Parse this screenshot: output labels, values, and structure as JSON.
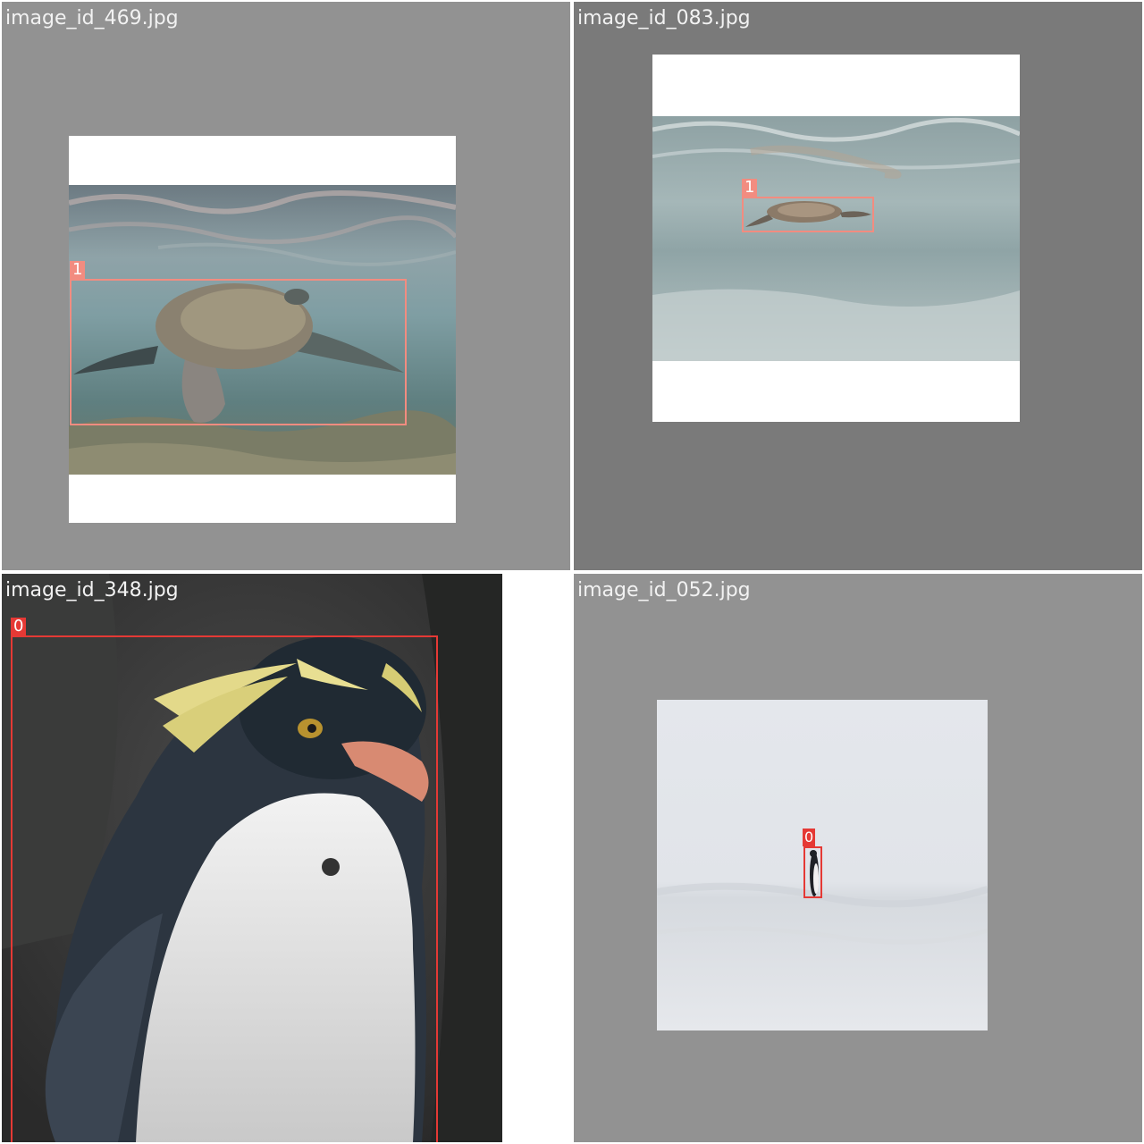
{
  "tiles": [
    {
      "filename": "image_id_469.jpg",
      "subject": "sea turtle swimming underwater",
      "background": "#929292",
      "detections": [
        {
          "class_id": "1",
          "color": "#f28c80"
        }
      ]
    },
    {
      "filename": "image_id_083.jpg",
      "subject": "sea turtle near water surface",
      "background": "#7a7a7a",
      "detections": [
        {
          "class_id": "1",
          "color": "#f28c80"
        }
      ]
    },
    {
      "filename": "image_id_348.jpg",
      "subject": "rockhopper penguin portrait",
      "background": "#ffffff",
      "detections": [
        {
          "class_id": "0",
          "color": "#e53935"
        }
      ]
    },
    {
      "filename": "image_id_052.jpg",
      "subject": "penguin standing on snow",
      "background": "#929292",
      "detections": [
        {
          "class_id": "0",
          "color": "#e53935"
        }
      ]
    }
  ]
}
